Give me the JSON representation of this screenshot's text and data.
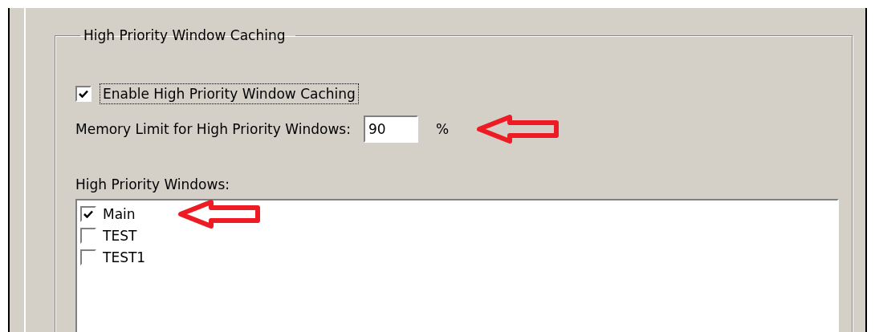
{
  "group": {
    "title": "High Priority Window Caching"
  },
  "enable_caching": {
    "label": "Enable High Priority Window Caching",
    "checked": true
  },
  "memory_limit": {
    "label": "Memory Limit for High Priority Windows:",
    "value": "90",
    "unit": "%"
  },
  "windows_list": {
    "label": "High Priority Windows:",
    "items": [
      {
        "label": "Main",
        "checked": true
      },
      {
        "label": "TEST",
        "checked": false
      },
      {
        "label": "TEST1",
        "checked": false
      }
    ]
  }
}
